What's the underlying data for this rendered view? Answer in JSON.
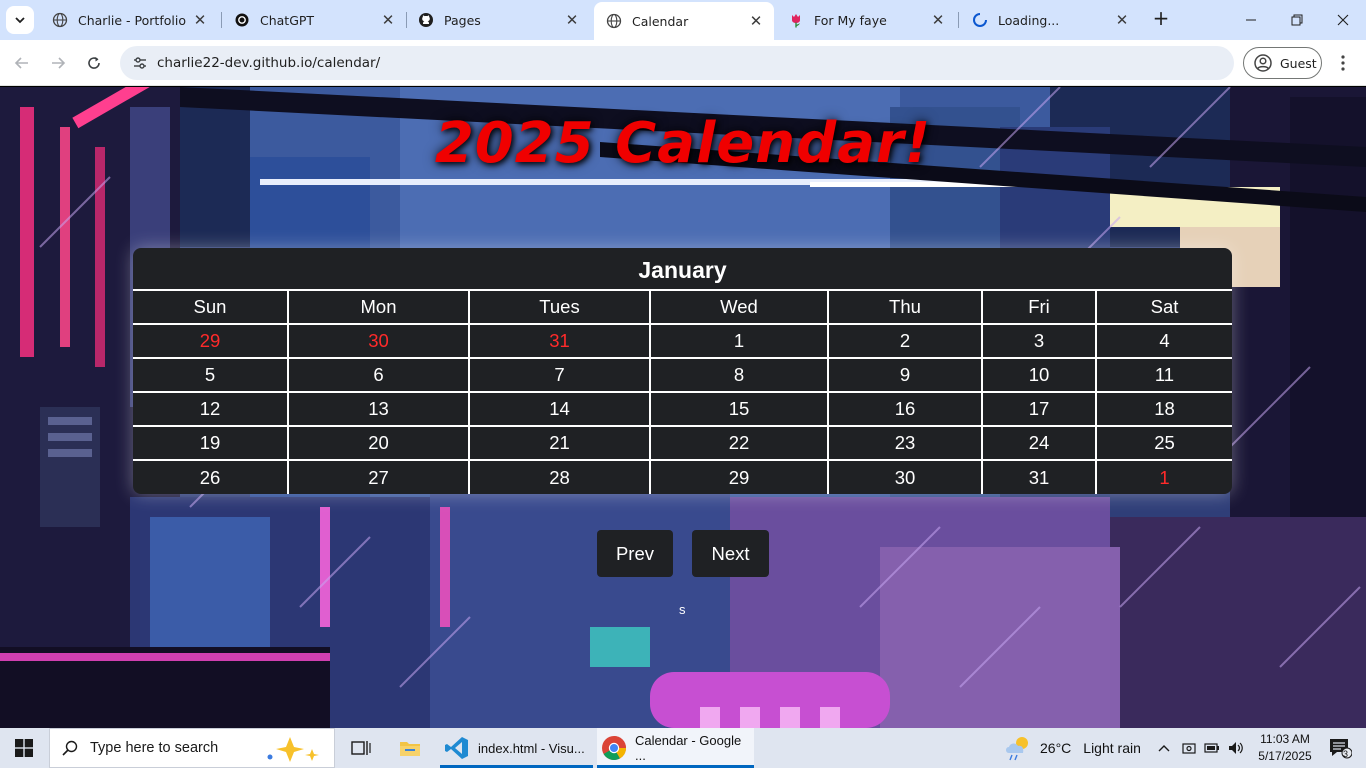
{
  "browser": {
    "tabs": [
      {
        "title": "Charlie - Portfolio",
        "favicon": "globe-icon",
        "active": false
      },
      {
        "title": "ChatGPT",
        "favicon": "chatgpt-icon",
        "active": false
      },
      {
        "title": "Pages",
        "favicon": "github-icon",
        "active": false
      },
      {
        "title": "Calendar",
        "favicon": "globe-icon",
        "active": true
      },
      {
        "title": "For My faye",
        "favicon": "tulip-icon",
        "active": false
      },
      {
        "title": "Loading...",
        "favicon": "loading-spinner-icon",
        "active": false
      }
    ],
    "url": "charlie22-dev.github.io/calendar/",
    "profile_label": "Guest"
  },
  "page": {
    "title": "2025 Calendar!",
    "calendar": {
      "month": "January",
      "weekdays": [
        "Sun",
        "Mon",
        "Tues",
        "Wed",
        "Thu",
        "Fri",
        "Sat"
      ],
      "weeks": [
        [
          {
            "d": "29",
            "other": true
          },
          {
            "d": "30",
            "other": true
          },
          {
            "d": "31",
            "other": true
          },
          {
            "d": "1"
          },
          {
            "d": "2"
          },
          {
            "d": "3"
          },
          {
            "d": "4"
          }
        ],
        [
          {
            "d": "5"
          },
          {
            "d": "6"
          },
          {
            "d": "7"
          },
          {
            "d": "8"
          },
          {
            "d": "9"
          },
          {
            "d": "10"
          },
          {
            "d": "11"
          }
        ],
        [
          {
            "d": "12"
          },
          {
            "d": "13"
          },
          {
            "d": "14"
          },
          {
            "d": "15"
          },
          {
            "d": "16"
          },
          {
            "d": "17"
          },
          {
            "d": "18"
          }
        ],
        [
          {
            "d": "19"
          },
          {
            "d": "20"
          },
          {
            "d": "21"
          },
          {
            "d": "22"
          },
          {
            "d": "23"
          },
          {
            "d": "24"
          },
          {
            "d": "25"
          }
        ],
        [
          {
            "d": "26"
          },
          {
            "d": "27"
          },
          {
            "d": "28"
          },
          {
            "d": "29"
          },
          {
            "d": "30"
          },
          {
            "d": "31"
          },
          {
            "d": "1",
            "other": true
          }
        ]
      ]
    },
    "prev_label": "Prev",
    "next_label": "Next",
    "stray_text": "s",
    "colors": {
      "title": "#f00000",
      "other_month_day": "#ff2a2a",
      "calendar_bg": "#1f2124"
    }
  },
  "taskbar": {
    "search_placeholder": "Type here to search",
    "apps": [
      {
        "label": "index.html - Visu...",
        "icon": "vscode-icon"
      },
      {
        "label": "Calendar - Google ...",
        "icon": "chrome-icon"
      }
    ],
    "weather": {
      "temp": "26°C",
      "condition": "Light rain"
    },
    "time": "11:03 AM",
    "date": "5/17/2025",
    "notification_count": "3"
  }
}
